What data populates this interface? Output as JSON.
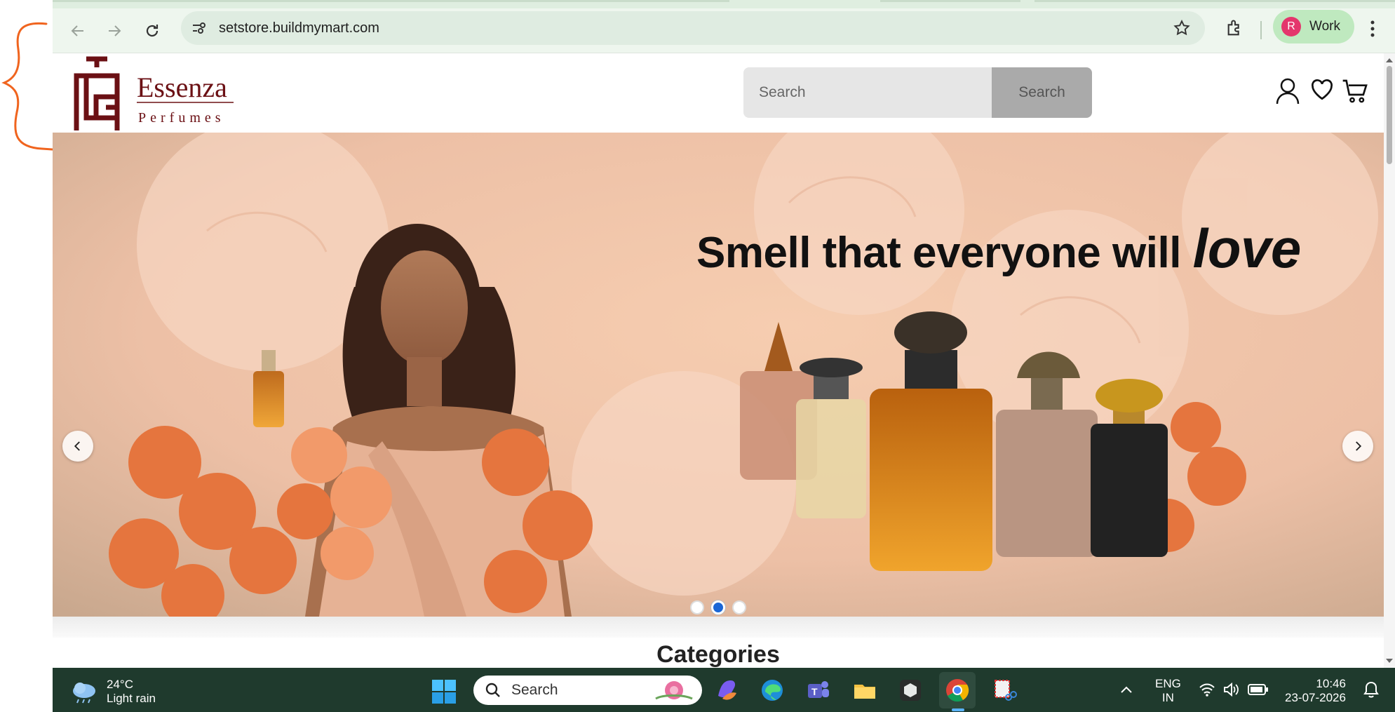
{
  "browser": {
    "url": "setstore.buildmymart.com",
    "profile_initial": "R",
    "profile_label": "Work"
  },
  "header": {
    "search_placeholder": "Search",
    "search_button": "Search"
  },
  "hero": {
    "headline": "Smell that everyone will",
    "headline_emphasis": "love",
    "active_slide": 2,
    "slide_count": 3
  },
  "section": {
    "categories_title": "Categories"
  },
  "taskbar": {
    "temperature": "24°C",
    "weather": "Light rain",
    "search_label": "Search",
    "lang_top": "ENG",
    "lang_bottom": "IN",
    "time": "10:46",
    "date": "23-07-2026"
  },
  "colors": {
    "brand": "#6b1014",
    "annotation": "#f0641e",
    "taskbar": "#1f3a2d",
    "active_dot": "#1a66d6"
  }
}
